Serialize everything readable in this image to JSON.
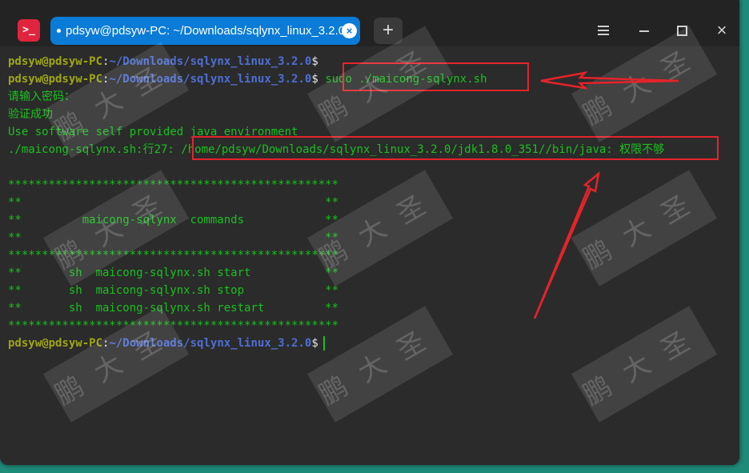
{
  "titlebar": {
    "app_icon": "terminal-icon",
    "tab_title": "pdsyw@pdsyw-PC: ~/Downloads/sqlynx_linux_3.2.0",
    "new_tab_label": "+",
    "menu_icon": "hamburger-icon",
    "minimize_icon": "minimize-icon",
    "maximize_icon": "maximize-icon",
    "close_label": "×"
  },
  "terminal": {
    "prompt_user": "pdsyw@pdsyw-PC",
    "prompt_colon": ":",
    "prompt_path": "~/Downloads/sqlynx_linux_3.2.0",
    "prompt_symbol": "$",
    "command": "sudo ./maicong-sqlynx.sh",
    "password_prompt": "请输入密码：",
    "auth_success": "验证成功",
    "java_env": "Use software self provided java environment",
    "error_prefix": "./maicong-sqlynx.sh:行27: ",
    "error_path": "/home/pdsyw/Downloads/sqlynx_linux_3.2.0/jdk1.8.0_351//bin/java: ",
    "error_message": "权限不够",
    "banner": [
      "*************************************************",
      "**                                             **",
      "**         maicong-sqlynx  commands            **",
      "**                                             **",
      "*************************************************",
      "**       sh  maicong-sqlynx.sh start           **",
      "**       sh  maicong-sqlynx.sh stop            **",
      "**       sh  maicong-sqlynx.sh restart         **",
      "*************************************************"
    ]
  },
  "watermark": "鹏大圣",
  "colors": {
    "prompt_user": "#9ea614",
    "prompt_path": "#4d6fd4",
    "output_green": "#19c11e",
    "annotation_red": "#e5232a",
    "tab_blue": "#0a7bd6"
  }
}
